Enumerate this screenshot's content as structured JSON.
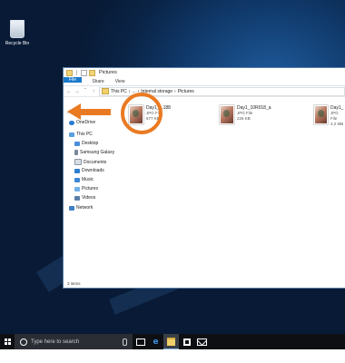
{
  "desktop": {
    "recycle_bin_label": "Recycle Bin"
  },
  "explorer": {
    "title": "Pictures",
    "ribbon_tabs": [
      "File",
      "Home",
      "Share",
      "View"
    ],
    "breadcrumb": [
      "This PC",
      "...",
      "Internal storage",
      "Pictures"
    ],
    "nav_pane": {
      "quick_access_glyph": "‹",
      "onedrive": "OneDrive",
      "this_pc": "This PC",
      "items": [
        "Desktop",
        "Samsung Galaxy",
        "Documents",
        "Downloads",
        "Music",
        "Pictures",
        "Videos"
      ],
      "network": "Network"
    },
    "files": [
      {
        "name": "Day1_...188",
        "type": "JPG File",
        "size": "677 KB"
      },
      {
        "name": "Day1_10R018_a",
        "type": "JPG File",
        "size": "226 KB"
      },
      {
        "name": "Day1_",
        "type": "JPG File",
        "size": "4.2 MB"
      }
    ],
    "status": "3 items"
  },
  "taskbar": {
    "search_placeholder": "Type here to search"
  },
  "colors": {
    "callout": "#ea7a22",
    "accent": "#1979ca",
    "taskbar": "#0d0f13"
  }
}
